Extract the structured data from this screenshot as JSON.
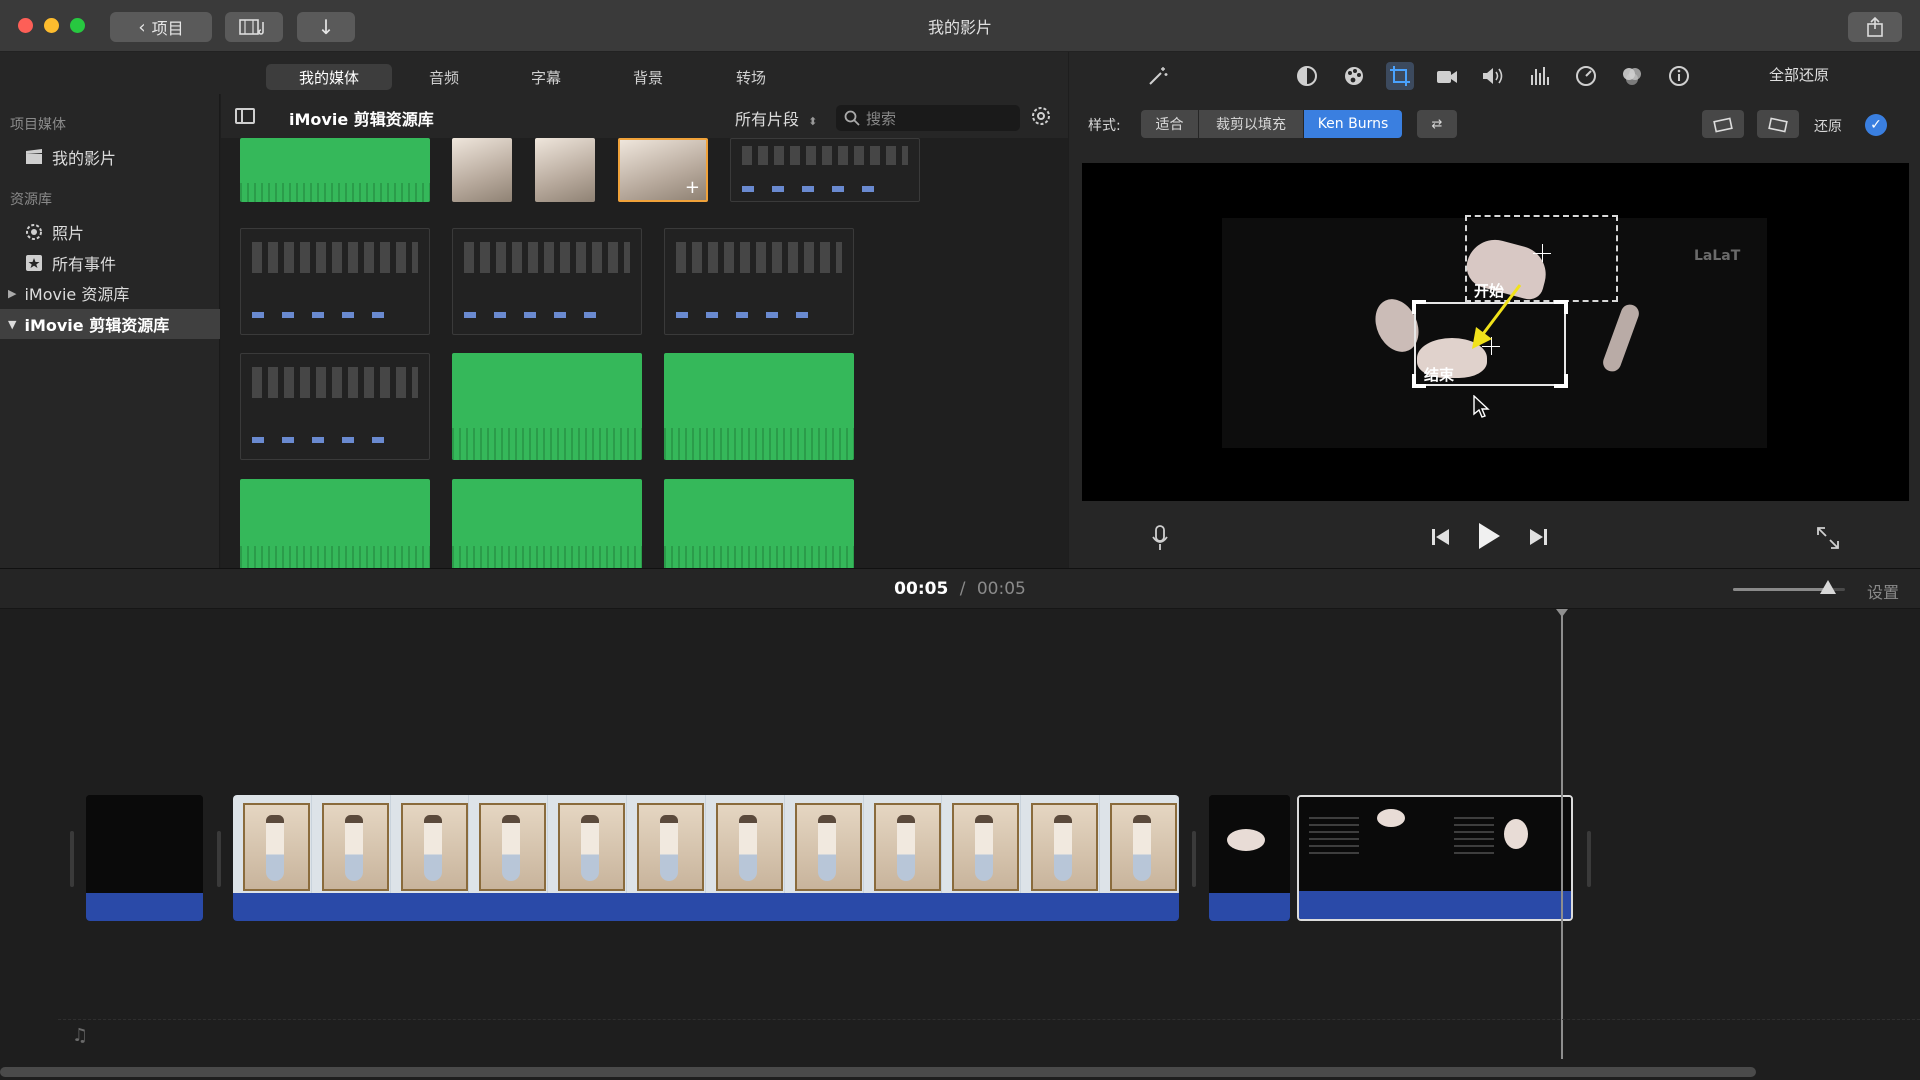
{
  "window": {
    "title": "我的影片",
    "back_label": "项目"
  },
  "media_tabs": [
    "我的媒体",
    "音频",
    "字幕",
    "背景",
    "转场"
  ],
  "sidebar": {
    "project_media_header": "项目媒体",
    "my_movie": "我的影片",
    "libraries_header": "资源库",
    "photos": "照片",
    "all_events": "所有事件",
    "imovie_library": "iMovie 资源库",
    "clip_library": "iMovie 剪辑资源库"
  },
  "browser": {
    "title": "iMovie 剪辑资源库",
    "filter": "所有片段",
    "search_placeholder": "搜索"
  },
  "viewer": {
    "reset_all": "全部还原",
    "style_label": "样式:",
    "style_options": [
      "适合",
      "裁剪以填充",
      "Ken Burns"
    ],
    "selected_style": "Ken Burns",
    "reset": "还原",
    "start_label": "开始",
    "end_label": "结束",
    "watermark": "LaLaT",
    "accent_color": "#3a7fe0"
  },
  "timeline": {
    "current_time": "00:05",
    "separator": "/",
    "total_time": "00:05",
    "settings_label": "设置",
    "zoom_level": 0.85
  },
  "icons": {
    "back": "chevron-left-icon",
    "share": "share-icon",
    "magic_wand": "magic-wand-icon",
    "crop": "crop-icon",
    "microphone": "microphone-icon",
    "play": "play-icon",
    "fullscreen": "fullscreen-icon"
  }
}
